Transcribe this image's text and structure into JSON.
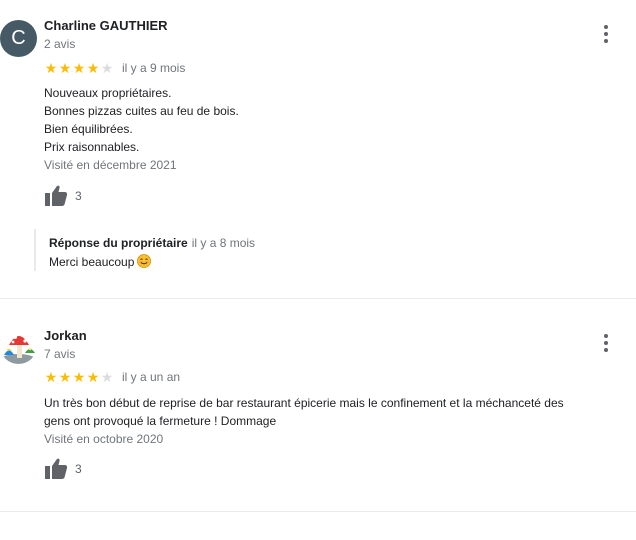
{
  "reviews": [
    {
      "avatar_letter": "C",
      "avatar_color": "#455a64",
      "name": "Charline GAUTHIER",
      "reviews_count": "2 avis",
      "rating": 4,
      "date": "il y a 9 mois",
      "text_lines": [
        "Nouveaux propriétaires.",
        "Bonnes pizzas cuites au feu de bois.",
        "Bien équilibrées.",
        "Prix raisonnables."
      ],
      "visited": "Visité en décembre 2021",
      "likes": "3",
      "owner_reply": {
        "title": "Réponse du propriétaire",
        "date": "il y a 8 mois",
        "text": "Merci beaucoup"
      }
    },
    {
      "avatar_icon": "mushroom-avatar-icon",
      "name": "Jorkan",
      "reviews_count": "7 avis",
      "rating": 4,
      "date": "il y a un an",
      "text_lines": [
        "Un très bon début de reprise de bar restaurant épicerie mais le confinement et la méchanceté des",
        "gens ont provoqué la fermeture ! Dommage"
      ],
      "visited": "Visité en octobre 2020",
      "likes": "3"
    }
  ],
  "colors": {
    "star": "#fbbc04",
    "star_empty": "#dadce0",
    "muted": "#70757a"
  }
}
